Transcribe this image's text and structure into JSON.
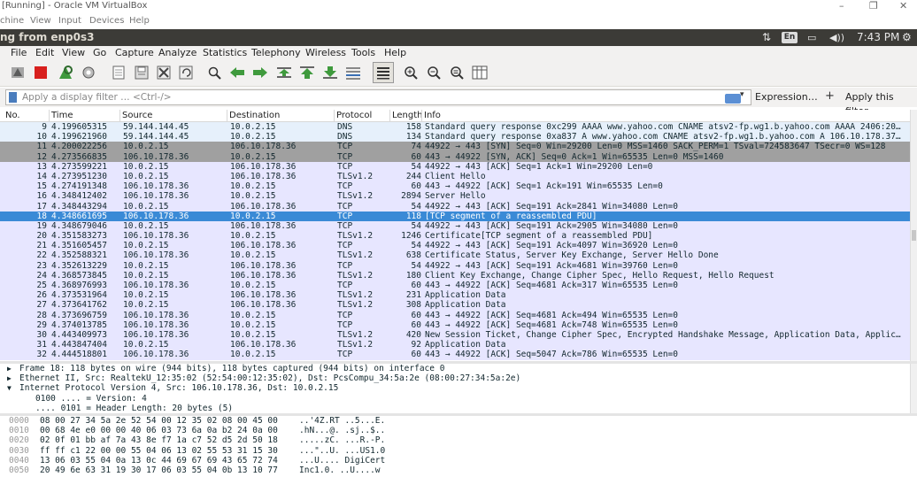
{
  "host": {
    "title": "[Running] - Oracle VM VirtualBox",
    "menu": [
      "chine",
      "View",
      "Input",
      "Devices",
      "Help"
    ],
    "controls": [
      "–",
      "❐",
      "✕"
    ]
  },
  "panel": {
    "title": "ng from enp0s3",
    "lang": "En",
    "time": "7:43 PM"
  },
  "menubar": [
    "File",
    "Edit",
    "View",
    "Go",
    "Capture",
    "Analyze",
    "Statistics",
    "Telephony",
    "Wireless",
    "Tools",
    "Help"
  ],
  "filter": {
    "placeholder": "Apply a display filter … <Ctrl-/>",
    "expression": "Expression…",
    "plus": "+",
    "apply": "Apply this filter"
  },
  "columns": [
    "No.",
    "Time",
    "Source",
    "Destination",
    "Protocol",
    "Length",
    "Info"
  ],
  "colors": {
    "dns": "#e6f0fb",
    "tcp": "#e7e6ff",
    "syn": "#a0a0a0",
    "selected": "#3a8ad6"
  },
  "packets": [
    {
      "no": "9",
      "time": "4.199605315",
      "src": "59.144.144.45",
      "dst": "10.0.2.15",
      "proto": "DNS",
      "len": "158",
      "info": "Standard query response 0xc299 AAAA www.yahoo.com CNAME atsv2-fp.wg1.b.yahoo.com AAAA 2406:20…",
      "style": "dns"
    },
    {
      "no": "10",
      "time": "4.199621960",
      "src": "59.144.144.45",
      "dst": "10.0.2.15",
      "proto": "DNS",
      "len": "134",
      "info": "Standard query response 0xa837 A www.yahoo.com CNAME atsv2-fp.wg1.b.yahoo.com A 106.10.178.37…",
      "style": "dns"
    },
    {
      "no": "11",
      "time": "4.200022256",
      "src": "10.0.2.15",
      "dst": "106.10.178.36",
      "proto": "TCP",
      "len": "74",
      "info": "44922 → 443 [SYN] Seq=0 Win=29200 Len=0 MSS=1460 SACK_PERM=1 TSval=724583647 TSecr=0 WS=128",
      "style": "syn"
    },
    {
      "no": "12",
      "time": "4.273566835",
      "src": "106.10.178.36",
      "dst": "10.0.2.15",
      "proto": "TCP",
      "len": "60",
      "info": "443 → 44922 [SYN, ACK] Seq=0 Ack=1 Win=65535 Len=0 MSS=1460",
      "style": "syn"
    },
    {
      "no": "13",
      "time": "4.273599221",
      "src": "10.0.2.15",
      "dst": "106.10.178.36",
      "proto": "TCP",
      "len": "54",
      "info": "44922 → 443 [ACK] Seq=1 Ack=1 Win=29200 Len=0",
      "style": "tcp"
    },
    {
      "no": "14",
      "time": "4.273951230",
      "src": "10.0.2.15",
      "dst": "106.10.178.36",
      "proto": "TLSv1.2",
      "len": "244",
      "info": "Client Hello",
      "style": "tcp"
    },
    {
      "no": "15",
      "time": "4.274191348",
      "src": "106.10.178.36",
      "dst": "10.0.2.15",
      "proto": "TCP",
      "len": "60",
      "info": "443 → 44922 [ACK] Seq=1 Ack=191 Win=65535 Len=0",
      "style": "tcp"
    },
    {
      "no": "16",
      "time": "4.348412402",
      "src": "106.10.178.36",
      "dst": "10.0.2.15",
      "proto": "TLSv1.2",
      "len": "2894",
      "info": "Server Hello",
      "style": "tcp"
    },
    {
      "no": "17",
      "time": "4.348443294",
      "src": "10.0.2.15",
      "dst": "106.10.178.36",
      "proto": "TCP",
      "len": "54",
      "info": "44922 → 443 [ACK] Seq=191 Ack=2841 Win=34080 Len=0",
      "style": "tcp"
    },
    {
      "no": "18",
      "time": "4.348661695",
      "src": "106.10.178.36",
      "dst": "10.0.2.15",
      "proto": "TCP",
      "len": "118",
      "info": "[TCP segment of a reassembled PDU]",
      "style": "selected"
    },
    {
      "no": "19",
      "time": "4.348679046",
      "src": "10.0.2.15",
      "dst": "106.10.178.36",
      "proto": "TCP",
      "len": "54",
      "info": "44922 → 443 [ACK] Seq=191 Ack=2905 Win=34080 Len=0",
      "style": "tcp"
    },
    {
      "no": "20",
      "time": "4.351583273",
      "src": "106.10.178.36",
      "dst": "10.0.2.15",
      "proto": "TLSv1.2",
      "len": "1246",
      "info": "Certificate[TCP segment of a reassembled PDU]",
      "style": "tcp"
    },
    {
      "no": "21",
      "time": "4.351605457",
      "src": "10.0.2.15",
      "dst": "106.10.178.36",
      "proto": "TCP",
      "len": "54",
      "info": "44922 → 443 [ACK] Seq=191 Ack=4097 Win=36920 Len=0",
      "style": "tcp"
    },
    {
      "no": "22",
      "time": "4.352588321",
      "src": "106.10.178.36",
      "dst": "10.0.2.15",
      "proto": "TLSv1.2",
      "len": "638",
      "info": "Certificate Status, Server Key Exchange, Server Hello Done",
      "style": "tcp"
    },
    {
      "no": "23",
      "time": "4.352613229",
      "src": "10.0.2.15",
      "dst": "106.10.178.36",
      "proto": "TCP",
      "len": "54",
      "info": "44922 → 443 [ACK] Seq=191 Ack=4681 Win=39760 Len=0",
      "style": "tcp"
    },
    {
      "no": "24",
      "time": "4.368573845",
      "src": "10.0.2.15",
      "dst": "106.10.178.36",
      "proto": "TLSv1.2",
      "len": "180",
      "info": "Client Key Exchange, Change Cipher Spec, Hello Request, Hello Request",
      "style": "tcp"
    },
    {
      "no": "25",
      "time": "4.368976993",
      "src": "106.10.178.36",
      "dst": "10.0.2.15",
      "proto": "TCP",
      "len": "60",
      "info": "443 → 44922 [ACK] Seq=4681 Ack=317 Win=65535 Len=0",
      "style": "tcp"
    },
    {
      "no": "26",
      "time": "4.373531964",
      "src": "10.0.2.15",
      "dst": "106.10.178.36",
      "proto": "TLSv1.2",
      "len": "231",
      "info": "Application Data",
      "style": "tcp"
    },
    {
      "no": "27",
      "time": "4.373641762",
      "src": "10.0.2.15",
      "dst": "106.10.178.36",
      "proto": "TLSv1.2",
      "len": "308",
      "info": "Application Data",
      "style": "tcp"
    },
    {
      "no": "28",
      "time": "4.373696759",
      "src": "106.10.178.36",
      "dst": "10.0.2.15",
      "proto": "TCP",
      "len": "60",
      "info": "443 → 44922 [ACK] Seq=4681 Ack=494 Win=65535 Len=0",
      "style": "tcp"
    },
    {
      "no": "29",
      "time": "4.374013785",
      "src": "106.10.178.36",
      "dst": "10.0.2.15",
      "proto": "TCP",
      "len": "60",
      "info": "443 → 44922 [ACK] Seq=4681 Ack=748 Win=65535 Len=0",
      "style": "tcp"
    },
    {
      "no": "30",
      "time": "4.443409973",
      "src": "106.10.178.36",
      "dst": "10.0.2.15",
      "proto": "TLSv1.2",
      "len": "420",
      "info": "New Session Ticket, Change Cipher Spec, Encrypted Handshake Message, Application Data, Applic…",
      "style": "tcp"
    },
    {
      "no": "31",
      "time": "4.443847404",
      "src": "10.0.2.15",
      "dst": "106.10.178.36",
      "proto": "TLSv1.2",
      "len": "92",
      "info": "Application Data",
      "style": "tcp"
    },
    {
      "no": "32",
      "time": "4.444518801",
      "src": "106.10.178.36",
      "dst": "10.0.2.15",
      "proto": "TCP",
      "len": "60",
      "info": "443 → 44922 [ACK] Seq=5047 Ack=786 Win=65535 Len=0",
      "style": "tcp"
    }
  ],
  "details": [
    {
      "arrow": "▶",
      "text": "Frame 18: 118 bytes on wire (944 bits), 118 bytes captured (944 bits) on interface 0",
      "indent": 0
    },
    {
      "arrow": "▶",
      "text": "Ethernet II, Src: RealtekU_12:35:02 (52:54:00:12:35:02), Dst: PcsCompu_34:5a:2e (08:00:27:34:5a:2e)",
      "indent": 0
    },
    {
      "arrow": "▼",
      "text": "Internet Protocol Version 4, Src: 106.10.178.36, Dst: 10.0.2.15",
      "indent": 0
    },
    {
      "arrow": "",
      "text": "0100 .... = Version: 4",
      "indent": 1
    },
    {
      "arrow": "",
      "text": ".... 0101 = Header Length: 20 bytes (5)",
      "indent": 1
    }
  ],
  "bytes": [
    {
      "off": "0000",
      "hex": "08 00 27 34 5a 2e 52 54  00 12 35 02 08 00 45 00",
      "ascii": "..'4Z.RT ..5...E."
    },
    {
      "off": "0010",
      "hex": "00 68 4e e0 00 00 40 06  03 73 6a 0a b2 24 0a 00",
      "ascii": ".hN...@. .sj..$.."
    },
    {
      "off": "0020",
      "hex": "02 0f 01 bb af 7a 43 8e  f7 1a c7 52 d5 2d 50 18",
      "ascii": ".....zC. ...R.-P."
    },
    {
      "off": "0030",
      "hex": "ff ff c1 22 00 00 55 04  06 13 02 55 53 31 15 30",
      "ascii": "...\"..U. ...US1.0"
    },
    {
      "off": "0040",
      "hex": "13 06 03 55 04 0a 13 0c  44 69 67 69 43 65 72 74",
      "ascii": "...U.... DigiCert"
    },
    {
      "off": "0050",
      "hex": "20 49 6e 63 31 19 30 17  06 03 55 04 0b 13 10 77",
      "ascii": " Inc1.0. ..U....w"
    }
  ]
}
